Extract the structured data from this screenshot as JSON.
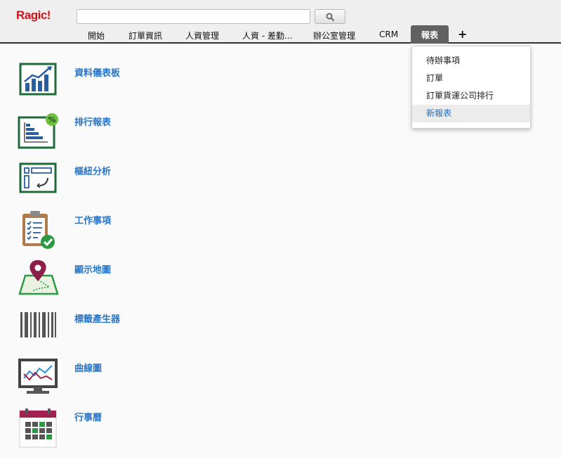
{
  "app": {
    "logo": "Ragic!"
  },
  "search": {
    "placeholder": ""
  },
  "tabs": [
    "開始",
    "訂單資訊",
    "人資管理",
    "人資 - 差勤...",
    "辦公室管理",
    "CRM"
  ],
  "active_tab": "報表",
  "add_tab": "+",
  "dropdown": {
    "items": [
      "待辦事項",
      "訂單",
      "訂單貨運公司排行",
      "新報表"
    ],
    "highlighted_index": 3
  },
  "report_types": [
    {
      "label": "資料儀表板",
      "icon": "dashboard-icon"
    },
    {
      "label": "排行報表",
      "icon": "ranking-report-icon"
    },
    {
      "label": "樞紐分析",
      "icon": "pivot-table-icon"
    },
    {
      "label": "工作事項",
      "icon": "clipboard-checklist-icon"
    },
    {
      "label": "顯示地圖",
      "icon": "map-pin-icon"
    },
    {
      "label": "標籤產生器",
      "icon": "barcode-icon"
    },
    {
      "label": "曲線圖",
      "icon": "line-chart-monitor-icon"
    },
    {
      "label": "行事曆",
      "icon": "calendar-icon"
    }
  ],
  "colors": {
    "logo": "#c8161d",
    "link": "#2a76c6",
    "active_tab_bg": "#616161",
    "icon_green": "#1e6b3a",
    "icon_blue": "#2a5e9e",
    "check_green": "#3aa84a",
    "map_pin": "#8c1f4a",
    "calendar_top": "#a3204f"
  }
}
